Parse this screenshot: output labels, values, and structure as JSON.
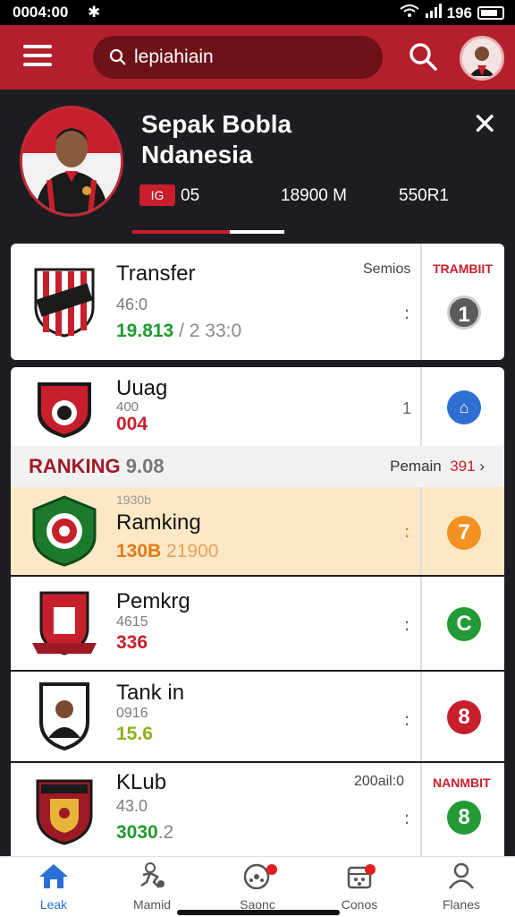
{
  "status": {
    "time": "0004:00",
    "battery": "196"
  },
  "topbar": {
    "search_text": "lepiahiain"
  },
  "hero": {
    "title_line1": "Sepak Bobla",
    "title_line2": "Ndanesia",
    "badge": "IG",
    "stat1": "05",
    "stat2": "18900 M",
    "stat3": "550R1",
    "progress": 0.64
  },
  "cards": [
    {
      "name": "Transfer",
      "sub": "46:0",
      "value": "19.813",
      "value2": "/ 2 33:0",
      "value_color": "#1f9a2c",
      "tag": "Semios",
      "right_label": "TRAMBIIT",
      "rank": "1",
      "rank_color": "#5b5b5b"
    },
    {
      "name": "Uuag",
      "sub": "400",
      "value": "004",
      "value_color": "#c81f2c",
      "tag": "1",
      "rank": "",
      "rank_color": "#2f6fd1"
    },
    {
      "name": "Ramking",
      "sub_top": "1930b",
      "value": "130B",
      "value2": "21900",
      "value_color": "#e47a12",
      "rank": "7",
      "rank_color": "#f39123"
    },
    {
      "name": "Pemkrg",
      "sub": "4615",
      "value": "336",
      "value_color": "#c81f2c",
      "rank": "C",
      "rank_color": "#239a35"
    },
    {
      "name": "Tank in",
      "sub": "0916",
      "value": "15.6",
      "value_color": "#8ab31f",
      "rank": "8",
      "rank_color": "#c81f2c"
    },
    {
      "name": "KLub",
      "sub": "43.0",
      "value": "3030",
      "value2": ".2",
      "value_color": "#1f9a2c",
      "tag": "200ail:0",
      "right_label": "NANMBIT",
      "rank": "8",
      "rank_color": "#239a35"
    }
  ],
  "ranking_header": {
    "title": "RANKING",
    "score": "9.08",
    "right": "Pemain",
    "right_num": "391"
  },
  "nav": [
    {
      "label": "Leak",
      "icon": "home-icon"
    },
    {
      "label": "Mamid",
      "icon": "player-icon"
    },
    {
      "label": "Saonc",
      "icon": "ball-icon"
    },
    {
      "label": "Conos",
      "icon": "calendar-icon"
    },
    {
      "label": "Flanes",
      "icon": "profile-icon"
    }
  ],
  "colors": {
    "primary": "#b31f2c",
    "dark": "#1d1d21",
    "accent_blue": "#2b6fd6"
  }
}
